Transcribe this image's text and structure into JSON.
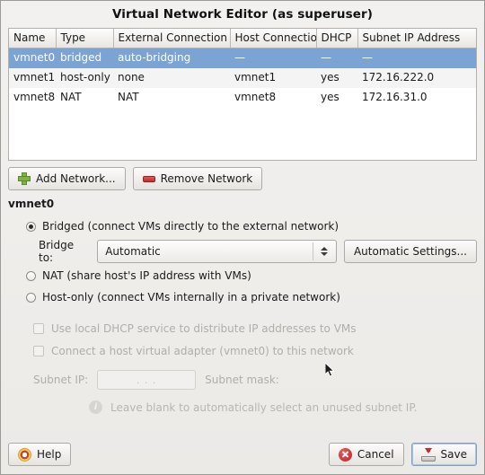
{
  "window": {
    "title": "Virtual Network Editor (as superuser)"
  },
  "table": {
    "columns": [
      "Name",
      "Type",
      "External Connection",
      "Host Connection",
      "DHCP",
      "Subnet IP Address"
    ],
    "rows": [
      {
        "name": "vmnet0",
        "type": "bridged",
        "external": "auto-bridging",
        "host": "—",
        "dhcp": "—",
        "subnet": "—",
        "selected": true
      },
      {
        "name": "vmnet1",
        "type": "host-only",
        "external": "none",
        "host": "vmnet1",
        "dhcp": "yes",
        "subnet": "172.16.222.0",
        "selected": false
      },
      {
        "name": "vmnet8",
        "type": "NAT",
        "external": "NAT",
        "host": "vmnet8",
        "dhcp": "yes",
        "subnet": "172.16.31.0",
        "selected": false
      }
    ]
  },
  "toolbar": {
    "add_label": "Add Network...",
    "add_icon": "plus-icon",
    "remove_label": "Remove Network",
    "remove_icon": "minus-icon"
  },
  "details": {
    "section_label": "vmnet0",
    "options": [
      {
        "label": "Bridged (connect VMs directly to the external network)",
        "selected": true
      },
      {
        "label": "NAT (share host's IP address with VMs)",
        "selected": false
      },
      {
        "label": "Host-only (connect VMs internally in a private network)",
        "selected": false
      }
    ],
    "bridge_to_label": "Bridge to:",
    "bridge_to_value": "Automatic",
    "bridge_to_options": [
      "Automatic"
    ],
    "automatic_settings_label": "Automatic Settings...",
    "checkboxes": [
      {
        "label": "Use local DHCP service to distribute IP addresses to VMs",
        "checked": false,
        "disabled": true
      },
      {
        "label": "Connect a host virtual adapter (vmnet0) to this network",
        "checked": false,
        "disabled": true
      }
    ],
    "subnet_ip_label": "Subnet IP:",
    "subnet_ip_value": ".   .   .",
    "subnet_mask_label": "Subnet mask:",
    "subnet_mask_value": "",
    "hint_icon": "info-icon",
    "hint_text": "Leave blank to automatically select an unused subnet IP."
  },
  "footer": {
    "help_label": "Help",
    "help_icon": "lifebuoy-icon",
    "cancel_label": "Cancel",
    "cancel_icon": "cancel-x-icon",
    "save_label": "Save",
    "save_icon": "save-download-icon"
  },
  "colors": {
    "selection": "#7ba3d4",
    "window_bg": "#ededeb",
    "accent_green": "#7cb342",
    "accent_red": "#c42b2b"
  }
}
